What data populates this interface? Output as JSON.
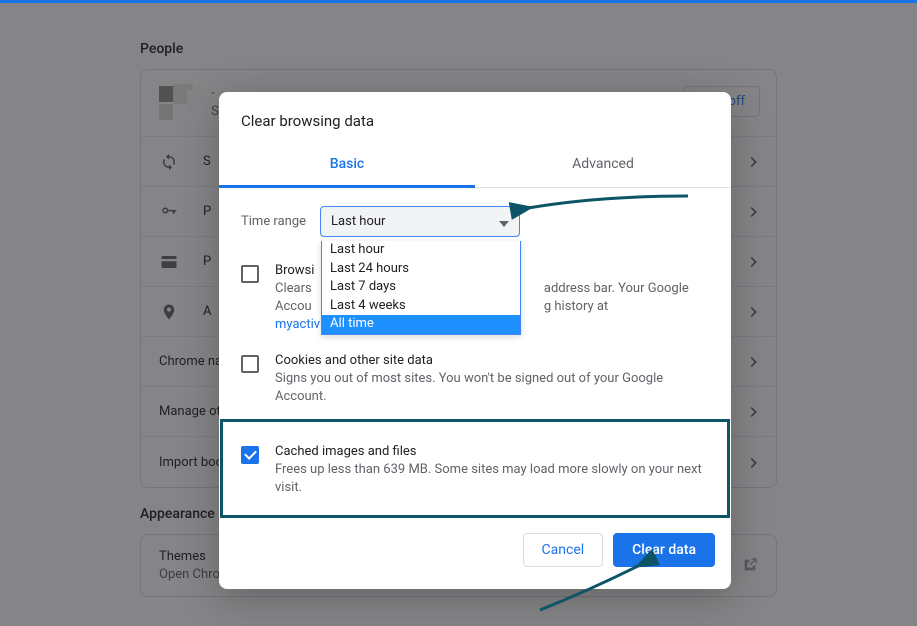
{
  "sections": {
    "people": "People",
    "appearance": "Appearance"
  },
  "profile": {
    "line1": "-",
    "line2": "S",
    "turn_off": "Turn off"
  },
  "rows": [
    "S",
    "P",
    "P",
    "A",
    "Chrome na",
    "Manage otl",
    "Import boo"
  ],
  "appearance_card": {
    "title": "Themes",
    "subtitle": "Open Chrome Web Store"
  },
  "dialog": {
    "title": "Clear browsing data",
    "tabs": {
      "basic": "Basic",
      "advanced": "Advanced"
    },
    "time_range_label": "Time range",
    "selected_value": "Last hour",
    "options": [
      "Last hour",
      "Last 24 hours",
      "Last 7 days",
      "Last 4 weeks",
      "All time"
    ],
    "selected_index": 4,
    "items": [
      {
        "title": "Browsi",
        "body_prefix": "Clears",
        "body_suffix": "address bar. Your Google",
        "body_line2_prefix": "Accou",
        "body_line2_suffix": "g history at",
        "link": "myactivity.google.com",
        "checked": false
      },
      {
        "title": "Cookies and other site data",
        "body": "Signs you out of most sites. You won't be signed out of your Google Account.",
        "checked": false
      },
      {
        "title": "Cached images and files",
        "body": "Frees up less than 639 MB. Some sites may load more slowly on your next visit.",
        "checked": true
      }
    ],
    "buttons": {
      "cancel": "Cancel",
      "clear": "Clear data"
    }
  }
}
